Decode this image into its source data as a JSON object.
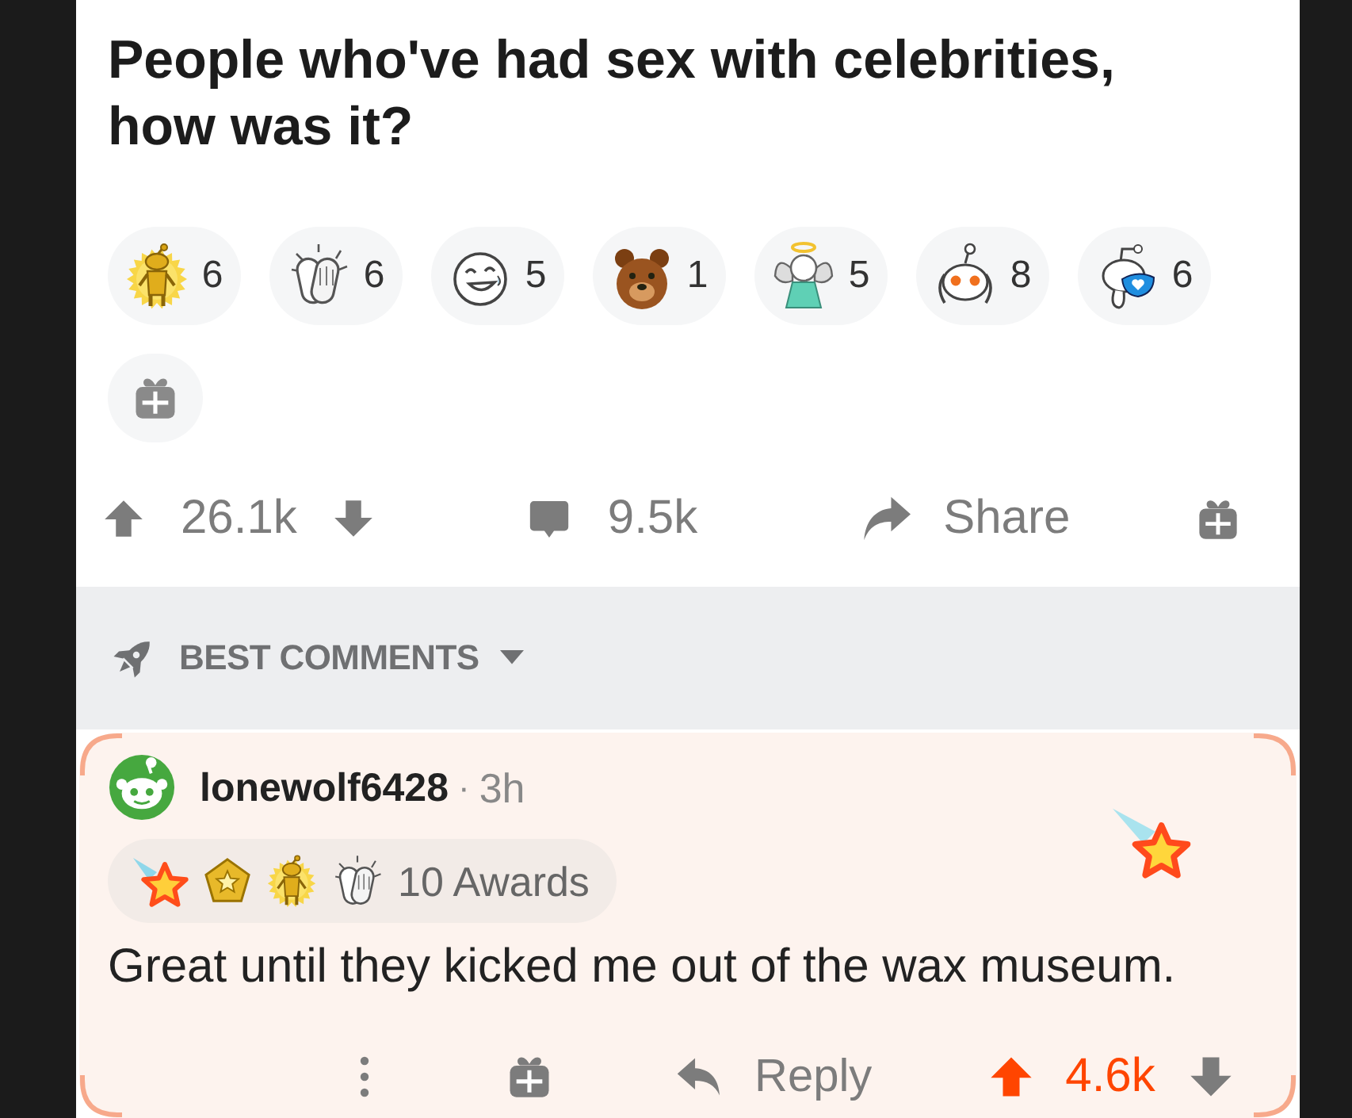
{
  "post": {
    "title": "People who've had sex with celebrities, how was it?"
  },
  "awards": [
    {
      "count": "6"
    },
    {
      "count": "6"
    },
    {
      "count": "5"
    },
    {
      "count": "1"
    },
    {
      "count": "5"
    },
    {
      "count": "8"
    },
    {
      "count": "6"
    }
  ],
  "actions": {
    "upvoted": false,
    "score": "26.1k",
    "comments": "9.5k",
    "share": "Share"
  },
  "sort": {
    "label": "BEST COMMENTS"
  },
  "comment": {
    "highlighted": true,
    "author": "lonewolf6428",
    "separator": "·",
    "age": "3h",
    "awards_label": "10 Awards",
    "body": "Great until they kicked me out of the wax museum.",
    "reply": "Reply",
    "upvoted": true,
    "score": "4.6k"
  }
}
